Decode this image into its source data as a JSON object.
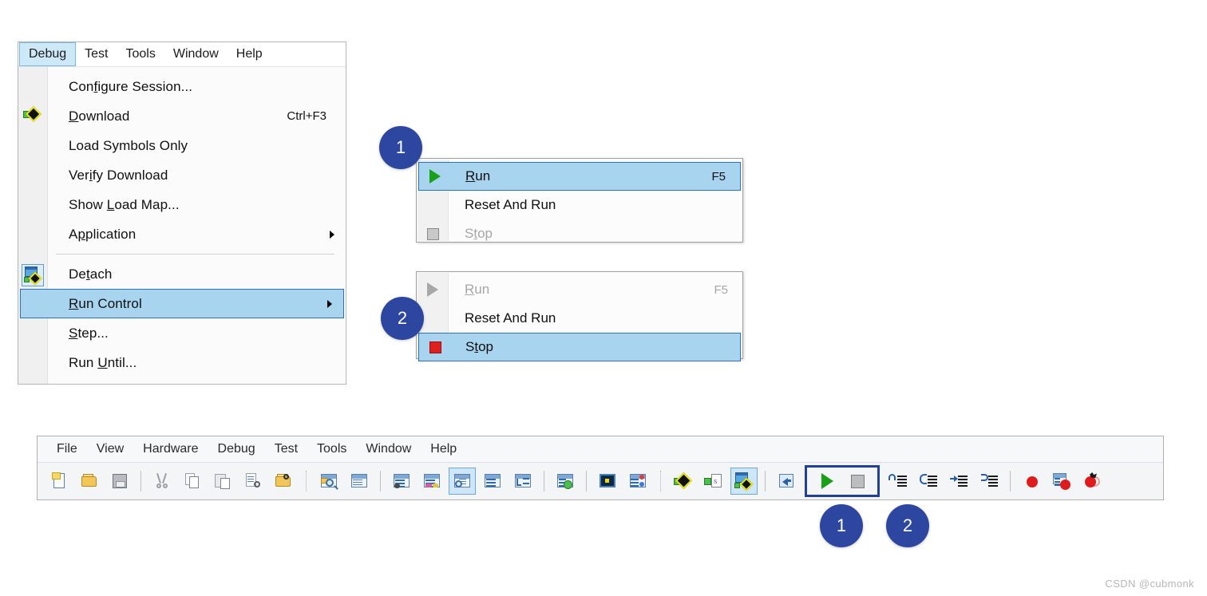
{
  "debug_menu": {
    "menubar": [
      {
        "label": "Debug",
        "active": true
      },
      {
        "label": "Test",
        "active": false
      },
      {
        "label": "Tools",
        "active": false
      },
      {
        "label": "Window",
        "active": false
      },
      {
        "label": "Help",
        "active": false
      }
    ],
    "items": [
      {
        "label": "Configure Session...",
        "accel": "",
        "icon": "",
        "selected": false,
        "submenu": false
      },
      {
        "label": "Download",
        "accel": "Ctrl+F3",
        "icon": "download-diamond-icon",
        "selected": false,
        "submenu": false
      },
      {
        "label": "Load Symbols Only",
        "accel": "",
        "icon": "",
        "selected": false,
        "submenu": false
      },
      {
        "label": "Verify Download",
        "accel": "",
        "icon": "",
        "selected": false,
        "submenu": false
      },
      {
        "label": "Show Load Map...",
        "accel": "",
        "icon": "",
        "selected": false,
        "submenu": false
      },
      {
        "label": "Application",
        "accel": "",
        "icon": "",
        "selected": false,
        "submenu": true
      },
      {
        "label": "Detach",
        "accel": "",
        "icon": "detach-monitor-icon",
        "selected": false,
        "submenu": false
      },
      {
        "label": "Run Control",
        "accel": "",
        "icon": "",
        "selected": true,
        "submenu": true
      },
      {
        "label": "Step...",
        "accel": "",
        "icon": "",
        "selected": false,
        "submenu": false
      },
      {
        "label": "Run Until...",
        "accel": "",
        "icon": "",
        "selected": false,
        "submenu": false
      }
    ]
  },
  "popup1": {
    "badge": "1",
    "items": [
      {
        "label": "Run",
        "accel": "F5",
        "icon": "play-icon",
        "selected": true,
        "disabled": false
      },
      {
        "label": "Reset And Run",
        "accel": "",
        "icon": "",
        "selected": false,
        "disabled": false
      },
      {
        "label": "Stop",
        "accel": "",
        "icon": "stop-square-icon",
        "selected": false,
        "disabled": true
      }
    ]
  },
  "popup2": {
    "badge": "2",
    "items": [
      {
        "label": "Run",
        "accel": "F5",
        "icon": "play-icon",
        "selected": false,
        "disabled": true
      },
      {
        "label": "Reset And Run",
        "accel": "",
        "icon": "",
        "selected": false,
        "disabled": false
      },
      {
        "label": "Stop",
        "accel": "",
        "icon": "stop-square-red-icon",
        "selected": true,
        "disabled": false
      }
    ]
  },
  "toolbar": {
    "menubar": [
      "File",
      "View",
      "Hardware",
      "Debug",
      "Test",
      "Tools",
      "Window",
      "Help"
    ],
    "badges": [
      "1",
      "2"
    ],
    "icons": [
      {
        "name": "new-file-icon",
        "active": false
      },
      {
        "name": "open-folder-icon",
        "active": false
      },
      {
        "name": "save-icon",
        "active": false
      },
      {
        "name": "separator",
        "active": false
      },
      {
        "name": "cut-icon",
        "active": false
      },
      {
        "name": "copy-icon",
        "active": false
      },
      {
        "name": "paste-icon",
        "active": false
      },
      {
        "name": "find-in-file-icon",
        "active": false
      },
      {
        "name": "find-in-folder-icon",
        "active": false
      },
      {
        "name": "separator-dotted",
        "active": false
      },
      {
        "name": "search-window-icon",
        "active": false
      },
      {
        "name": "text-window-icon",
        "active": false
      },
      {
        "name": "separator",
        "active": false
      },
      {
        "name": "memory-window-icon",
        "active": false
      },
      {
        "name": "variables-window-icon",
        "active": false
      },
      {
        "name": "watch-window-icon",
        "active": true
      },
      {
        "name": "list-window-icon",
        "active": false
      },
      {
        "name": "tree-window-icon",
        "active": false
      },
      {
        "name": "separator",
        "active": false
      },
      {
        "name": "add-window-icon",
        "active": false
      },
      {
        "name": "separator",
        "active": false
      },
      {
        "name": "console-window-icon",
        "active": false
      },
      {
        "name": "script-window-icon",
        "active": false
      },
      {
        "name": "separator-dotted",
        "active": false
      },
      {
        "name": "download-diamond-icon",
        "active": false
      },
      {
        "name": "load-symbols-icon",
        "active": false
      },
      {
        "name": "detach-monitor-icon",
        "active": true
      },
      {
        "name": "separator",
        "active": false
      },
      {
        "name": "back-arrow-icon",
        "active": false
      },
      {
        "name": "run-icon",
        "active": false
      },
      {
        "name": "stop-icon",
        "active": false
      },
      {
        "name": "step-into-icon",
        "active": false
      },
      {
        "name": "step-over-icon",
        "active": false
      },
      {
        "name": "step-in-icon",
        "active": false
      },
      {
        "name": "step-out-icon",
        "active": false
      },
      {
        "name": "separator",
        "active": false
      },
      {
        "name": "breakpoint-icon",
        "active": false
      },
      {
        "name": "breakpoint-window-icon",
        "active": false
      },
      {
        "name": "breakpoint-toggle-icon",
        "active": false
      }
    ]
  },
  "watermark": "CSDN @cubmonk",
  "colors": {
    "badge_blue": "#2d46a0",
    "selection_fill": "#a8d4f0",
    "selection_border": "#2b72b8",
    "menubar_active": "#cde8f7",
    "run_green": "#18a018",
    "stop_red": "#e02020",
    "highlight_box": "#21409a"
  }
}
